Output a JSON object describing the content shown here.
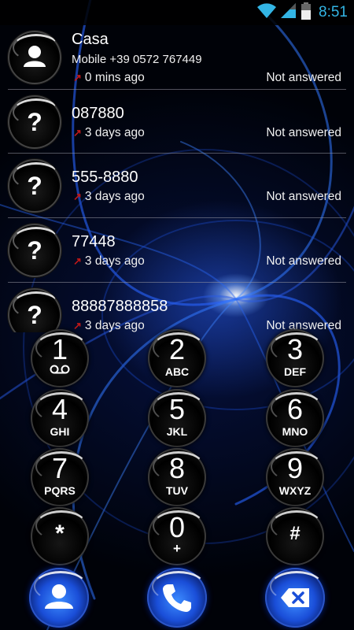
{
  "status_bar": {
    "time": "8:51",
    "icons": [
      "wifi-icon",
      "cellular-signal-icon",
      "battery-icon"
    ],
    "accent_color": "#33b5e5"
  },
  "call_log": [
    {
      "name": "Casa",
      "detail": "Mobile +39 0572 767449",
      "time_ago": "0 mins ago",
      "status": "Not answered",
      "avatar": "contact-icon"
    },
    {
      "name": "087880",
      "time_ago": "3 days ago",
      "status": "Not answered",
      "avatar": "?"
    },
    {
      "name": "555-8880",
      "time_ago": "3 days ago",
      "status": "Not answered",
      "avatar": "?"
    },
    {
      "name": "77448",
      "time_ago": "3 days ago",
      "status": "Not answered",
      "avatar": "?"
    },
    {
      "name": "88887888858",
      "time_ago": "3 days ago",
      "status": "Not answered",
      "avatar": "?"
    }
  ],
  "call_direction_icon": "outgoing-call-arrow-icon",
  "call_direction_color": "#c01818",
  "dialpad": [
    {
      "digit": "1",
      "letters": "",
      "icon": "voicemail-icon"
    },
    {
      "digit": "2",
      "letters": "ABC"
    },
    {
      "digit": "3",
      "letters": "DEF"
    },
    {
      "digit": "4",
      "letters": "GHI"
    },
    {
      "digit": "5",
      "letters": "JKL"
    },
    {
      "digit": "6",
      "letters": "MNO"
    },
    {
      "digit": "7",
      "letters": "PQRS"
    },
    {
      "digit": "8",
      "letters": "TUV"
    },
    {
      "digit": "9",
      "letters": "WXYZ"
    },
    {
      "digit": "*",
      "letters": ""
    },
    {
      "digit": "0",
      "letters": "+"
    },
    {
      "digit": "#",
      "letters": ""
    }
  ],
  "actions": [
    {
      "name": "contacts",
      "icon": "contacts-icon"
    },
    {
      "name": "call",
      "icon": "phone-icon"
    },
    {
      "name": "delete",
      "icon": "backspace-icon"
    }
  ],
  "theme": {
    "button_blue": "#1a4ed8",
    "background": "#000208"
  }
}
